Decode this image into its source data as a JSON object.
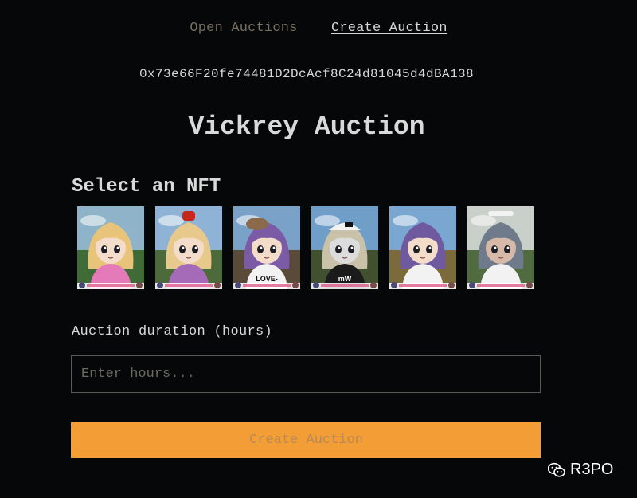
{
  "nav": {
    "open_auctions": "Open Auctions",
    "create_auction": "Create Auction"
  },
  "wallet_address": "0x73e66F20fe74481D2DcAcf8C24d81045d4dBA138",
  "title": "Vickrey Auction",
  "select_label": "Select an NFT",
  "nfts": [
    {
      "hair": "#e8c47a",
      "sky": "#8fb3c8",
      "ground": "#3f6b36",
      "shirt": "#e47ab8",
      "hat": "none",
      "skin": "#f3dcc9"
    },
    {
      "hair": "#e7c98c",
      "sky": "#8fb3d6",
      "ground": "#4d6b3a",
      "shirt": "#a66bb8",
      "hat": "red",
      "skin": "#f3dcc9"
    },
    {
      "hair": "#7b5aa6",
      "sky": "#7aa2c8",
      "ground": "#5a4a3a",
      "shirt": "#f2f2f2",
      "hat": "brown",
      "skin": "#f3dcc9",
      "shirt_text": "LOVE-"
    },
    {
      "hair": "#c9c1a8",
      "sky": "#6f9ec9",
      "ground": "#41502f",
      "shirt": "#1b1b1b",
      "hat": "cap",
      "skin": "#dcdcdc",
      "shirt_text": "mW"
    },
    {
      "hair": "#6f5aa0",
      "sky": "#7aa7d1",
      "ground": "#7b6a3a",
      "shirt": "#f2f2f2",
      "hat": "none",
      "skin": "#f3dcc9"
    },
    {
      "hair": "#6f7b8a",
      "sky": "#c9cfc9",
      "ground": "#4f6b3f",
      "shirt": "#f2f2f2",
      "hat": "maid",
      "skin": "#d6b9a8"
    }
  ],
  "duration_label": "Auction duration (hours)",
  "hours_input": {
    "value": "",
    "placeholder": "Enter hours..."
  },
  "submit_label": "Create Auction",
  "watermark": "R3PO",
  "colors": {
    "background": "#060708",
    "accent": "#f39d36",
    "nav_inactive": "#77705f"
  }
}
